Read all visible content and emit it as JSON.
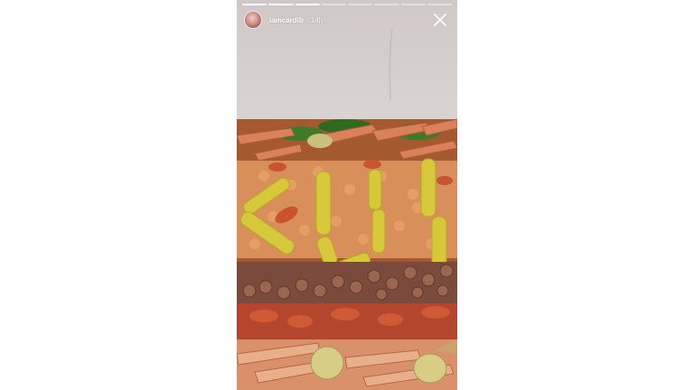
{
  "story": {
    "username": "iamcardib",
    "timestamp": "14h",
    "progress": {
      "segments": 8,
      "completed": 3
    }
  },
  "icons": {
    "close": "close-icon",
    "avatar": "avatar"
  },
  "colors": {
    "progress_done": "#ffffff",
    "progress_pending": "#ffffff73",
    "text": "#ffffff"
  }
}
